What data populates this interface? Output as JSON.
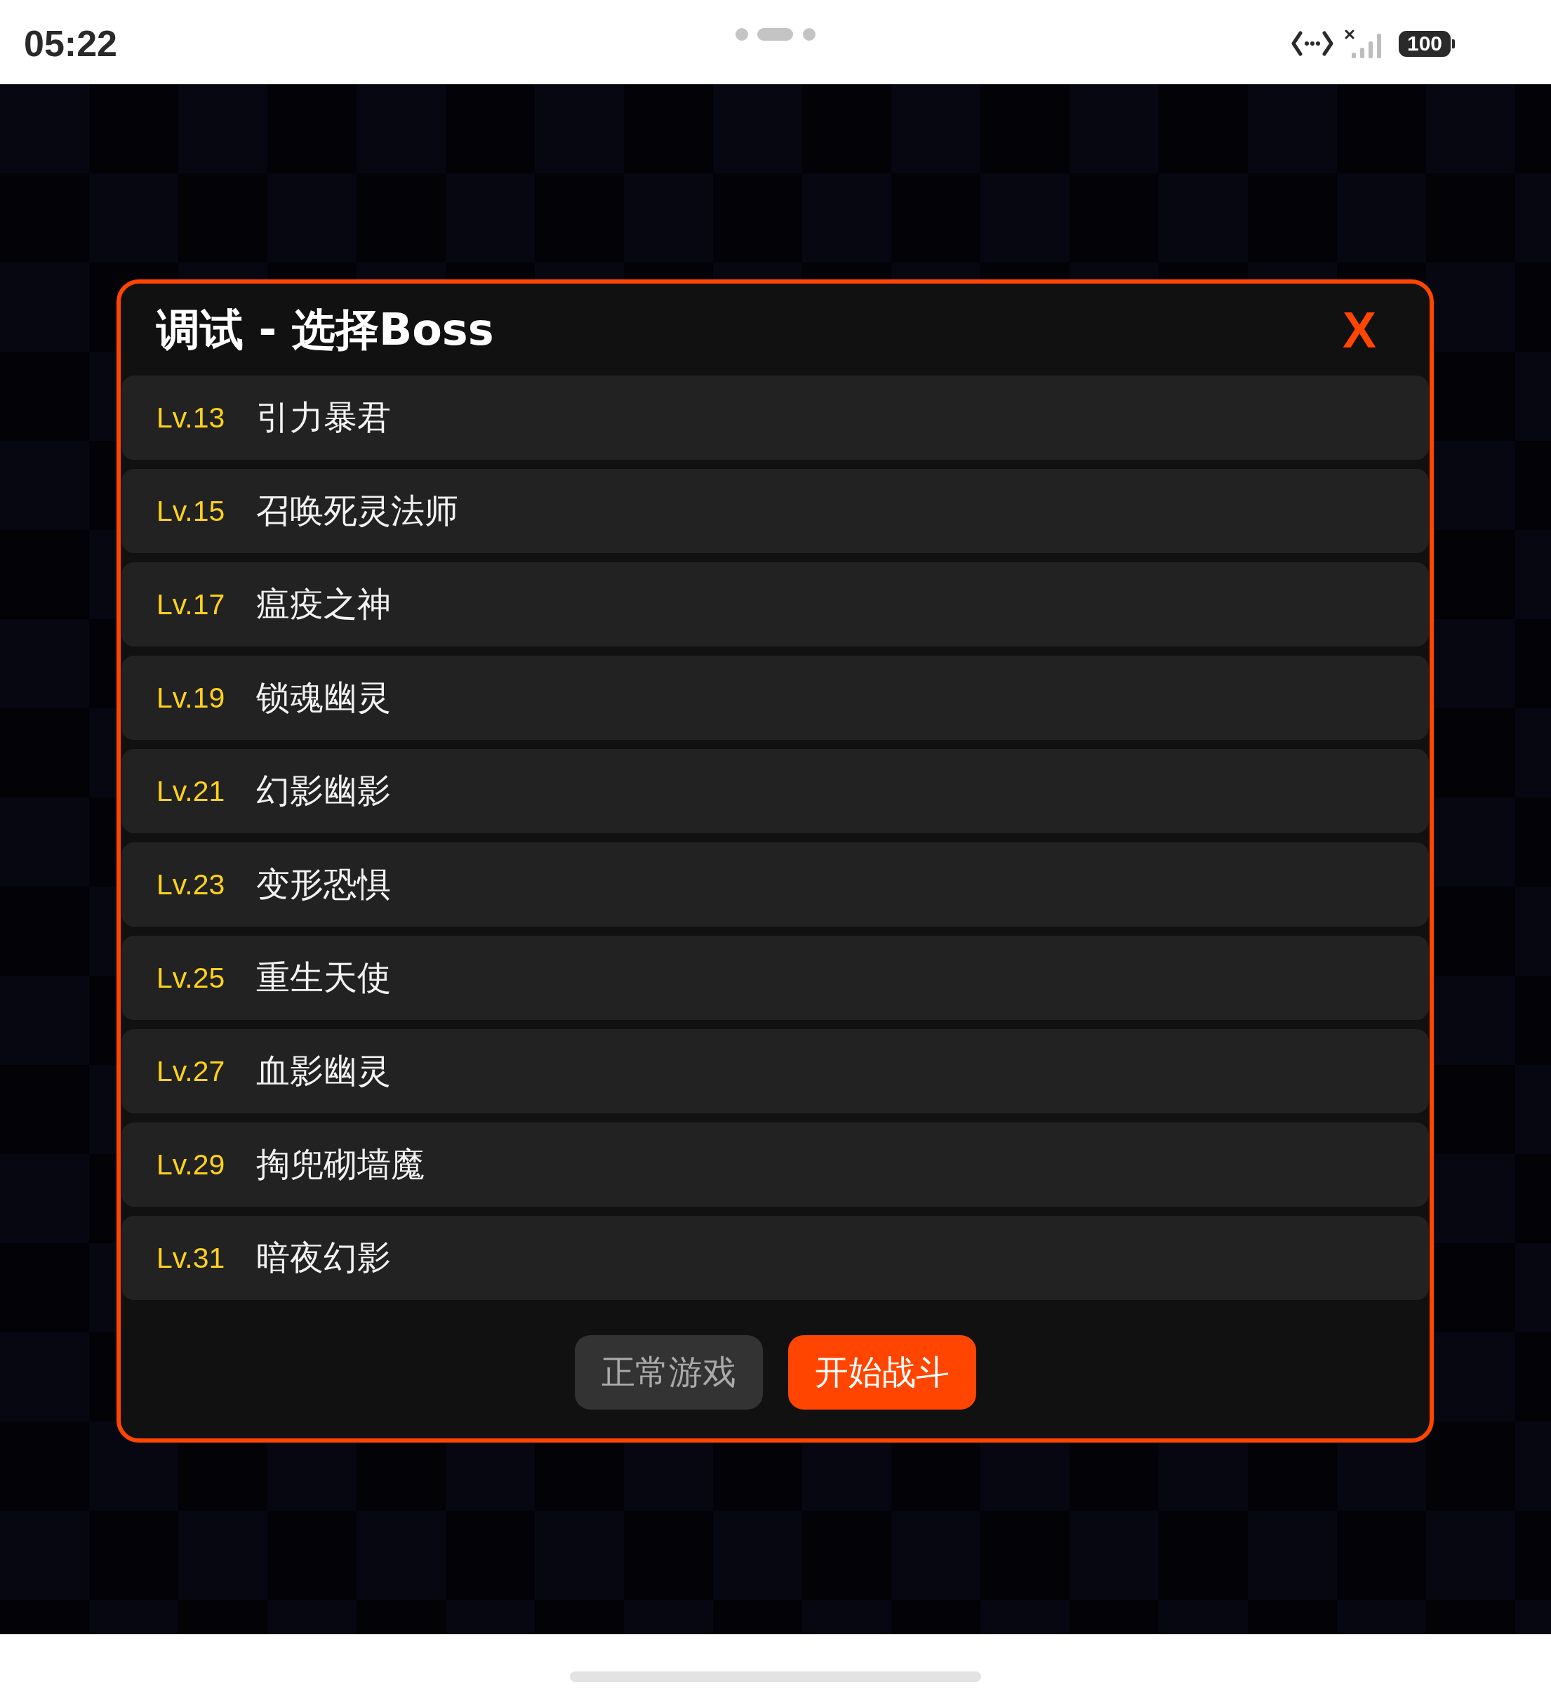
{
  "status_bar": {
    "time": "05:22",
    "battery": "100"
  },
  "dialog": {
    "title": "调试 - 选择Boss",
    "close": "X",
    "bosses": [
      {
        "level": "Lv.13",
        "name": "引力暴君"
      },
      {
        "level": "Lv.15",
        "name": "召唤死灵法师"
      },
      {
        "level": "Lv.17",
        "name": "瘟疫之神"
      },
      {
        "level": "Lv.19",
        "name": "锁魂幽灵"
      },
      {
        "level": "Lv.21",
        "name": "幻影幽影"
      },
      {
        "level": "Lv.23",
        "name": "变形恐惧"
      },
      {
        "level": "Lv.25",
        "name": "重生天使"
      },
      {
        "level": "Lv.27",
        "name": "血影幽灵"
      },
      {
        "level": "Lv.29",
        "name": "掏兜砌墙魔"
      },
      {
        "level": "Lv.31",
        "name": "暗夜幻影"
      }
    ],
    "buttons": [
      {
        "label": "正常游戏",
        "kind": "secondary"
      },
      {
        "label": "开始战斗",
        "kind": "primary"
      }
    ]
  }
}
